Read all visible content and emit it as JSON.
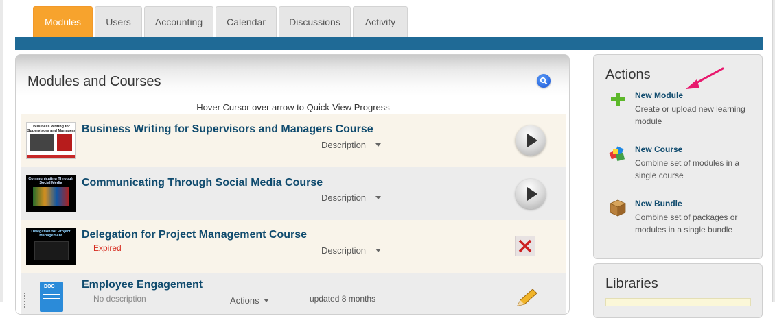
{
  "tabs": [
    {
      "label": "Modules",
      "active": true
    },
    {
      "label": "Users",
      "active": false
    },
    {
      "label": "Accounting",
      "active": false
    },
    {
      "label": "Calendar",
      "active": false
    },
    {
      "label": "Discussions",
      "active": false
    },
    {
      "label": "Activity",
      "active": false
    }
  ],
  "main": {
    "title": "Modules and Courses",
    "hint": "Hover Cursor over arrow to Quick-View Progress",
    "rows": [
      {
        "title": "Business Writing for Supervisors and Managers Course",
        "thumb_caption": "Business Writing for Supervisors and Managers",
        "description_label": "Description",
        "status_icon": "play-icon"
      },
      {
        "title": "Communicating Through Social Media Course",
        "thumb_caption": "Communicating Through Social Media",
        "description_label": "Description",
        "status_icon": "play-icon"
      },
      {
        "title": "Delegation for Project Management Course",
        "thumb_caption": "Delegation for Project Management",
        "status_label": "Expired",
        "description_label": "Description",
        "status_icon": "expired-x-icon"
      },
      {
        "title": "Employee Engagement",
        "thumb_caption": "DOC",
        "no_description": "No description",
        "actions_label": "Actions",
        "updated": "updated 8 months",
        "status_icon": "edit-pencil-icon"
      }
    ]
  },
  "sidebar": {
    "actions_title": "Actions",
    "actions": [
      {
        "label": "New Module",
        "sub": "Create or upload new learning module",
        "icon": "plus-icon"
      },
      {
        "label": "New Course",
        "sub": "Combine set of modules in a single course",
        "icon": "course-blocks-icon"
      },
      {
        "label": "New Bundle",
        "sub": "Combine set of packages or modules in a single bundle",
        "icon": "box-icon"
      }
    ],
    "libraries_title": "Libraries"
  },
  "colors": {
    "active_tab": "#f7a32d",
    "blue_bar": "#1f6a96",
    "title_link": "#104b6e",
    "expired": "#d62b1f",
    "arrow_annotation": "#e8196e"
  }
}
